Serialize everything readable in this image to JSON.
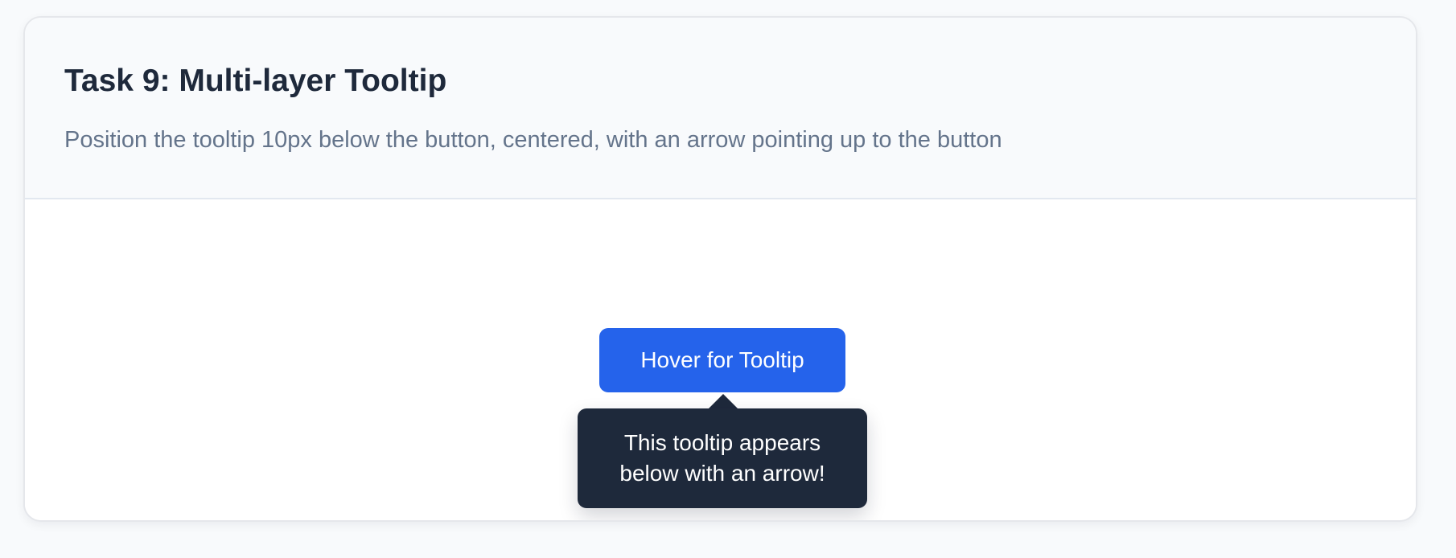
{
  "page": {
    "title": "Task 9: Multi-layer Tooltip",
    "description": "Position the tooltip 10px below the button, centered, with an arrow pointing up to the button"
  },
  "demo": {
    "button_label": "Hover for Tooltip",
    "tooltip_text": "This tooltip appears below with an arrow!"
  },
  "colors": {
    "button": "#2563eb",
    "tooltip": "#1e293b",
    "title": "#1e293b",
    "description": "#64748b"
  }
}
